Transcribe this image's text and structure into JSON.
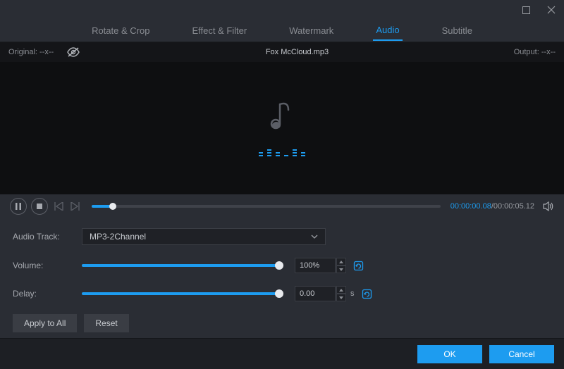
{
  "titlebar": {},
  "tabs": [
    "Rotate & Crop",
    "Effect & Filter",
    "Watermark",
    "Audio",
    "Subtitle"
  ],
  "activeTab": 3,
  "infoBar": {
    "originalLabel": "Original:",
    "originalValue": "--x--",
    "filename": "Fox McCloud.mp3",
    "outputLabel": "Output:",
    "outputValue": "--x--"
  },
  "playbar": {
    "currentTime": "00:00:00.08",
    "totalTime": "/00:00:05.12"
  },
  "controls": {
    "audioTrack": {
      "label": "Audio Track:",
      "value": "MP3-2Channel"
    },
    "volume": {
      "label": "Volume:",
      "value": "100%"
    },
    "delay": {
      "label": "Delay:",
      "value": "0.00",
      "unit": "s"
    },
    "applyToAll": "Apply to All",
    "reset": "Reset"
  },
  "footer": {
    "ok": "OK",
    "cancel": "Cancel"
  }
}
